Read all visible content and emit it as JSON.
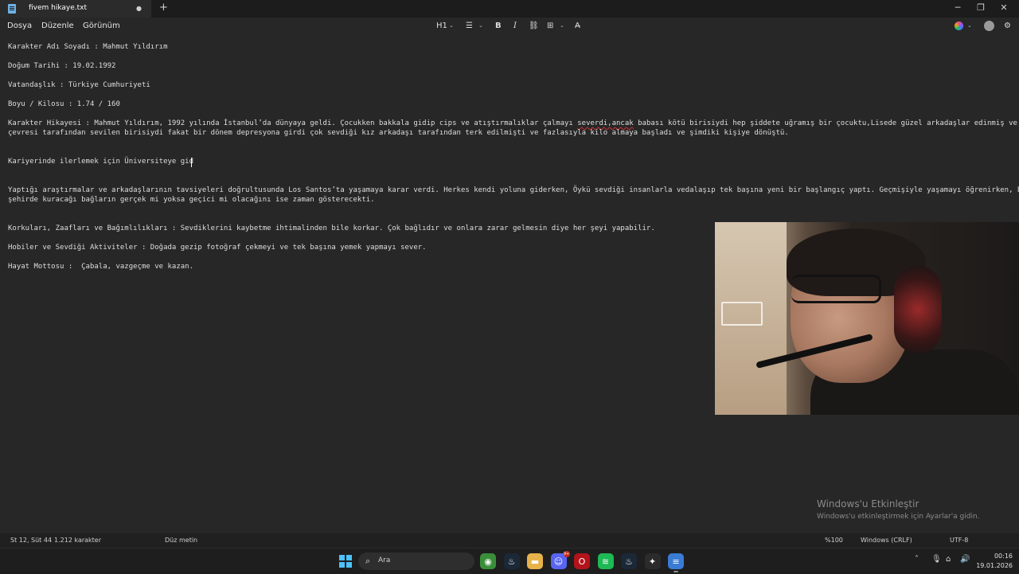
{
  "tab": {
    "title": "fivem hikaye.txt",
    "modified_dot": "●",
    "new_tab": "+"
  },
  "window_controls": {
    "minimize": "─",
    "maximize": "❐",
    "close": "✕"
  },
  "menu": [
    "Dosya",
    "Düzenle",
    "Görünüm"
  ],
  "toolbar": {
    "heading": "H1",
    "list": "☰",
    "bold": "B",
    "italic": "I",
    "link": "⛓",
    "table": "⊞",
    "clear_format": "A̶",
    "chevron": "⌄"
  },
  "document": {
    "name": "Karakter Adı Soyadı : Mahmut Yıldırım",
    "birth": "Doğum Tarihi : 19.02.1992",
    "citizenship": "Vatandaşlık : Türkiye Cumhuriyeti",
    "height_weight": "Boyu / Kilosu : 1.74 / 160",
    "story_l1_a": "Karakter Hikayesi : Mahmut Yıldırım, 1992 yılında İstanbul’da dünyaya geldi. Çocukken bakkala gidip cips ve atıştırmalıklar çalmayı ",
    "story_l1_err": "severdi,ancak",
    "story_l1_b": " babası kötü birisiydi hep şiddete uğramış bir çocuktu,Lisede güzel arkadaşlar edinmiş ve",
    "story_l2": "çevresi tarafından sevilen birisiydi fakat bir dönem depresyona girdi çok sevdiği kız arkadaşı tarafından terk edilmişti ve fazlasıyla kilo almaya başladı ve şimdiki kişiye dönüştü.",
    "career": "Kariyerinde ilerlemek için Üniversiteye gid",
    "research_l1": "Yaptığı araştırmalar ve arkadaşlarının tavsiyeleri doğrultusunda Los Santos’ta yaşamaya karar verdi. Herkes kendi yoluna giderken, Öykü sevdiği insanlarla vedalaşıp tek başına yeni bir başlangıç yaptı. Geçmişiyle yaşamayı öğrenirken, bu",
    "research_l2": "şehirde kuracağı bağların gerçek mi yoksa geçici mi olacağını ise zaman gösterecekti.",
    "fears": "Korkuları, Zaafları ve Bağımlılıkları : Sevdiklerini kaybetme ihtimalinden bile korkar. Çok bağlıdır ve onlara zarar gelmesin diye her şeyi yapabilir.",
    "hobbies": "Hobiler ve Sevdiği Aktiviteler : Doğada gezip fotoğraf çekmeyi ve tek başına yemek yapmayı sever.",
    "motto": "Hayat Mottosu :  Çabala, vazgeçme ve kazan."
  },
  "watermark": {
    "title": "Windows'u Etkinleştir",
    "subtitle": "Windows'u etkinleştirmek için Ayarlar'a gidin."
  },
  "status": {
    "position": "St 12, Süt 44",
    "chars": "1.212 karakter",
    "format": "Düz metin",
    "zoom": "%100",
    "line_endings": "Windows (CRLF)",
    "encoding": "UTF-8"
  },
  "taskbar": {
    "search_placeholder": "Ara",
    "apps": [
      {
        "icon": "chrome-icon",
        "glyph": "◉",
        "color": "#3a8e3a"
      },
      {
        "icon": "steam-icon",
        "glyph": "♨",
        "color": "#1b2838"
      },
      {
        "icon": "folder-icon",
        "glyph": "▬",
        "color": "#e8b24a"
      },
      {
        "icon": "discord-icon",
        "glyph": "☺",
        "color": "#5865f2",
        "badge": "9+"
      },
      {
        "icon": "opera-icon",
        "glyph": "O",
        "color": "#b3131b"
      },
      {
        "icon": "spotify-icon",
        "glyph": "≋",
        "color": "#1db954"
      },
      {
        "icon": "steam-icon-2",
        "glyph": "♨",
        "color": "#1b2838"
      },
      {
        "icon": "fivem-icon",
        "glyph": "✦",
        "color": "#2b2b2b"
      },
      {
        "icon": "notepad-icon",
        "glyph": "≡",
        "color": "#3a7bd5"
      }
    ],
    "clock_time": "00:16",
    "clock_date": "19.01.2026"
  }
}
